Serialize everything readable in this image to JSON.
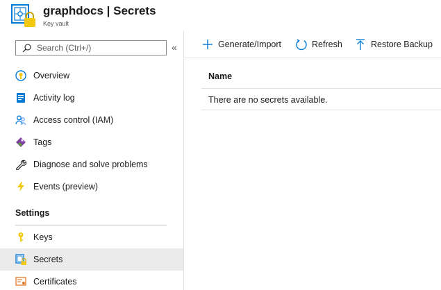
{
  "header": {
    "title": "graphdocs | Secrets",
    "subtitle": "Key vault",
    "icon": "key-vault-icon"
  },
  "sidebar": {
    "search_placeholder": "Search (Ctrl+/)",
    "collapse_glyph": "«",
    "items": [
      {
        "label": "Overview",
        "icon": "overview-icon"
      },
      {
        "label": "Activity log",
        "icon": "activity-log-icon"
      },
      {
        "label": "Access control (IAM)",
        "icon": "access-control-icon"
      },
      {
        "label": "Tags",
        "icon": "tags-icon"
      },
      {
        "label": "Diagnose and solve problems",
        "icon": "wrench-icon"
      },
      {
        "label": "Events (preview)",
        "icon": "lightning-icon"
      }
    ],
    "section_label": "Settings",
    "settings_items": [
      {
        "label": "Keys",
        "icon": "key-icon"
      },
      {
        "label": "Secrets",
        "icon": "secrets-icon",
        "selected": true
      },
      {
        "label": "Certificates",
        "icon": "certificates-icon"
      }
    ]
  },
  "toolbar": {
    "generate_label": "Generate/Import",
    "refresh_label": "Refresh",
    "restore_label": "Restore Backup"
  },
  "table": {
    "column_name": "Name",
    "empty_message": "There are no secrets available."
  },
  "colors": {
    "accent": "#0078d4",
    "selected_bg": "#ebebeb",
    "key_yellow": "#f2c811"
  }
}
